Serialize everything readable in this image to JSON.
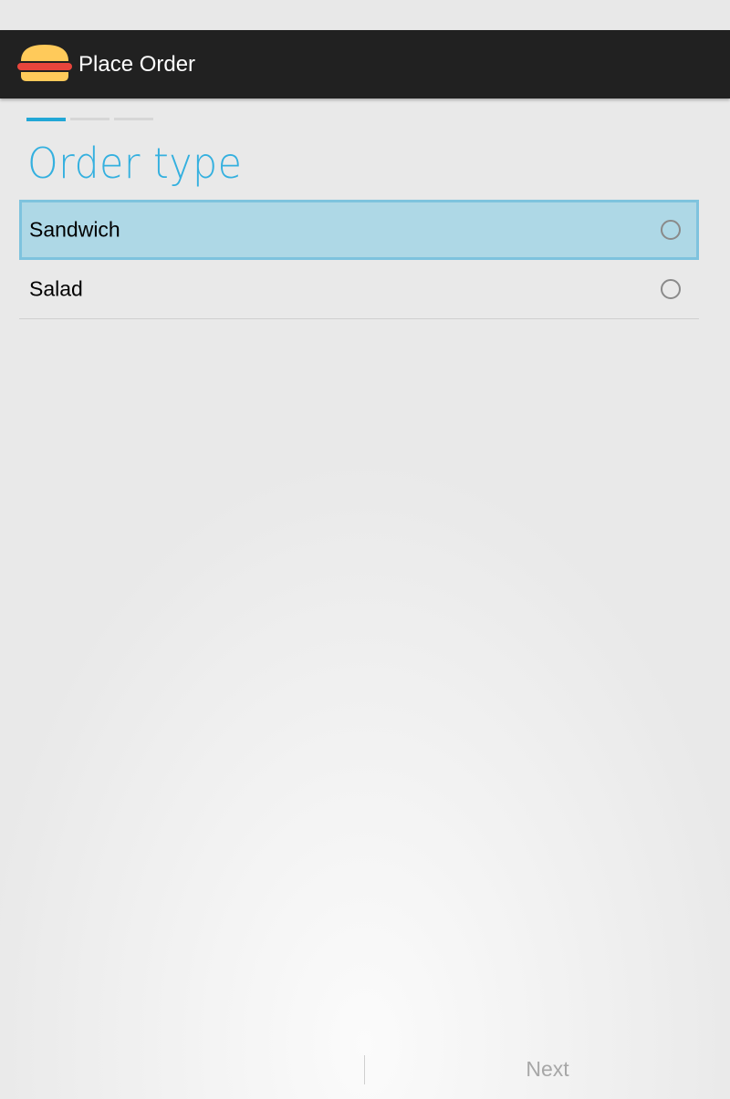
{
  "app": {
    "title": "Place Order",
    "icon": "burger-icon"
  },
  "wizard": {
    "steps_total": 3,
    "current_step": 1
  },
  "page": {
    "title": "Order type"
  },
  "options": [
    {
      "label": "Sandwich",
      "selected": false,
      "highlighted": true
    },
    {
      "label": "Salad",
      "selected": false,
      "highlighted": false
    }
  ],
  "footer": {
    "next_label": "Next",
    "next_enabled": false
  },
  "colors": {
    "accent": "#33b5e5",
    "highlight": "#aed8e6",
    "action_bar": "#212121"
  }
}
